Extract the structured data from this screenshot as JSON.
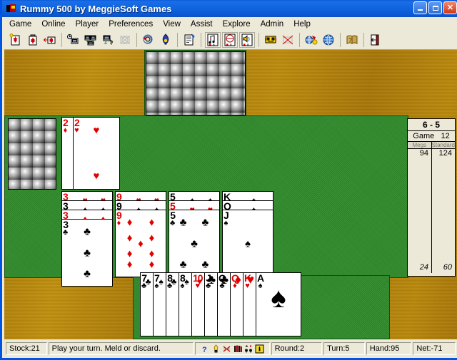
{
  "window": {
    "title": "Rummy 500 by MeggieSoft Games",
    "icon": "app-icon",
    "buttons": {
      "minimize": "–",
      "maximize": "□",
      "close": "✕"
    }
  },
  "menubar": {
    "items": [
      {
        "label": "Game"
      },
      {
        "label": "Online"
      },
      {
        "label": "Player"
      },
      {
        "label": "Preferences"
      },
      {
        "label": "View"
      },
      {
        "label": "Assist"
      },
      {
        "label": "Explore"
      },
      {
        "label": "Admin"
      },
      {
        "label": "Help"
      }
    ]
  },
  "toolbar": {
    "buttons": [
      {
        "name": "new-game-icon",
        "title": "New Game"
      },
      {
        "name": "save-game-icon",
        "title": "Save Game"
      },
      {
        "name": "open-game-icon",
        "title": "Open Game"
      },
      {
        "name": "connect-host-icon",
        "title": "Connect"
      },
      {
        "name": "network-game-icon",
        "title": "Network Game"
      },
      {
        "name": "find-opponent-icon",
        "title": "Find Opponent"
      },
      {
        "name": "disconnect-icon",
        "title": "Disconnect"
      },
      {
        "name": "undo-icon",
        "title": "Undo"
      },
      {
        "name": "hint-icon",
        "title": "Hint"
      },
      {
        "name": "scorecard-icon",
        "title": "Scorecard"
      },
      {
        "name": "sound-music-icon",
        "title": "Music"
      },
      {
        "name": "sound-mute-icon",
        "title": "Mute"
      },
      {
        "name": "sound-effects-icon",
        "title": "Sound Effects"
      },
      {
        "name": "chat-robot-icon",
        "title": "Chat"
      },
      {
        "name": "no-chat-icon",
        "title": "Chat Off"
      },
      {
        "name": "internet-connect-icon",
        "title": "Internet"
      },
      {
        "name": "globe-icon",
        "title": "Web"
      },
      {
        "name": "help-book-icon",
        "title": "Help Book"
      },
      {
        "name": "exit-icon",
        "title": "Exit"
      }
    ]
  },
  "table": {
    "stock_pile": {
      "name": "stock-pile",
      "card_back": "silver-spheres-on-yellow",
      "rows": 4,
      "cols": 3
    },
    "draw_spread": {
      "name": "draw-spread",
      "card_back": "silver-spheres-on-yellow",
      "rows": 4,
      "cols": 6
    },
    "discard_pile": {
      "name": "discard-pile",
      "cards": [
        {
          "rank": "2",
          "suit": "♦",
          "color": "red"
        },
        {
          "rank": "2",
          "suit": "♥",
          "color": "red"
        }
      ]
    },
    "melds": [
      {
        "name": "meld-threes",
        "cards": [
          {
            "rank": "3",
            "suit": "♥",
            "color": "red"
          },
          {
            "rank": "3",
            "suit": "♠",
            "color": "black"
          },
          {
            "rank": "3",
            "suit": "♦",
            "color": "red"
          },
          {
            "rank": "3",
            "suit": "♣",
            "color": "black"
          }
        ]
      },
      {
        "name": "meld-nines",
        "cards": [
          {
            "rank": "9",
            "suit": "♥",
            "color": "red"
          },
          {
            "rank": "9",
            "suit": "♠",
            "color": "black"
          },
          {
            "rank": "9",
            "suit": "♦",
            "color": "red"
          }
        ]
      },
      {
        "name": "meld-fives",
        "cards": [
          {
            "rank": "5",
            "suit": "♠",
            "color": "black"
          },
          {
            "rank": "5",
            "suit": "♥",
            "color": "red"
          },
          {
            "rank": "5",
            "suit": "♣",
            "color": "black"
          }
        ]
      },
      {
        "name": "meld-spade-run",
        "cards": [
          {
            "rank": "K",
            "suit": "♠",
            "color": "black"
          },
          {
            "rank": "Q",
            "suit": "♠",
            "color": "black"
          },
          {
            "rank": "J",
            "suit": "♠",
            "color": "black"
          }
        ]
      }
    ],
    "hand": {
      "name": "player-hand",
      "cards": [
        {
          "rank": "7",
          "suit": "♣",
          "color": "black",
          "face": false
        },
        {
          "rank": "7",
          "suit": "♠",
          "color": "black",
          "face": false
        },
        {
          "rank": "8",
          "suit": "♣",
          "color": "black",
          "face": false
        },
        {
          "rank": "8",
          "suit": "♠",
          "color": "black",
          "face": false
        },
        {
          "rank": "10",
          "suit": "♥",
          "color": "red",
          "face": false
        },
        {
          "rank": "J",
          "suit": "♣",
          "color": "black",
          "face": true
        },
        {
          "rank": "Q",
          "suit": "♣",
          "color": "black",
          "face": true
        },
        {
          "rank": "Q",
          "suit": "♦",
          "color": "red",
          "face": true
        },
        {
          "rank": "K",
          "suit": "♥",
          "color": "red",
          "face": true
        },
        {
          "rank": "A",
          "suit": "♠",
          "color": "black",
          "face": false
        }
      ]
    }
  },
  "scorepanel": {
    "title": "6 - 5",
    "game_label": "Game",
    "game_number": "12",
    "columns": [
      "Megs",
      "Standard"
    ],
    "totals": [
      "94",
      "124"
    ],
    "footer": [
      "24",
      "60"
    ]
  },
  "statusbar": {
    "stock": "Stock:21",
    "message": "Play your turn.  Meld or discard.",
    "icons": [
      {
        "name": "help-question-icon",
        "glyph": "?"
      },
      {
        "name": "hint-bulb-icon",
        "glyph": "bulb"
      },
      {
        "name": "no-draw-icon",
        "glyph": "cross"
      },
      {
        "name": "cards-fan-icon",
        "glyph": "fan"
      },
      {
        "name": "suits-icon",
        "glyph": "suits"
      },
      {
        "name": "alert-box-icon",
        "glyph": "box"
      }
    ],
    "round": "Round:2",
    "turn": "Turn:5",
    "hand": "Hand:95",
    "net": "Net:-71"
  },
  "colors": {
    "titlebar": "#0a5ad8",
    "chrome": "#ece9d8",
    "felt": "#2e8b28",
    "wood": "#b8860b",
    "red_suit": "#e00000",
    "black_suit": "#000000",
    "card_back_yellow": "#f2ef48"
  }
}
